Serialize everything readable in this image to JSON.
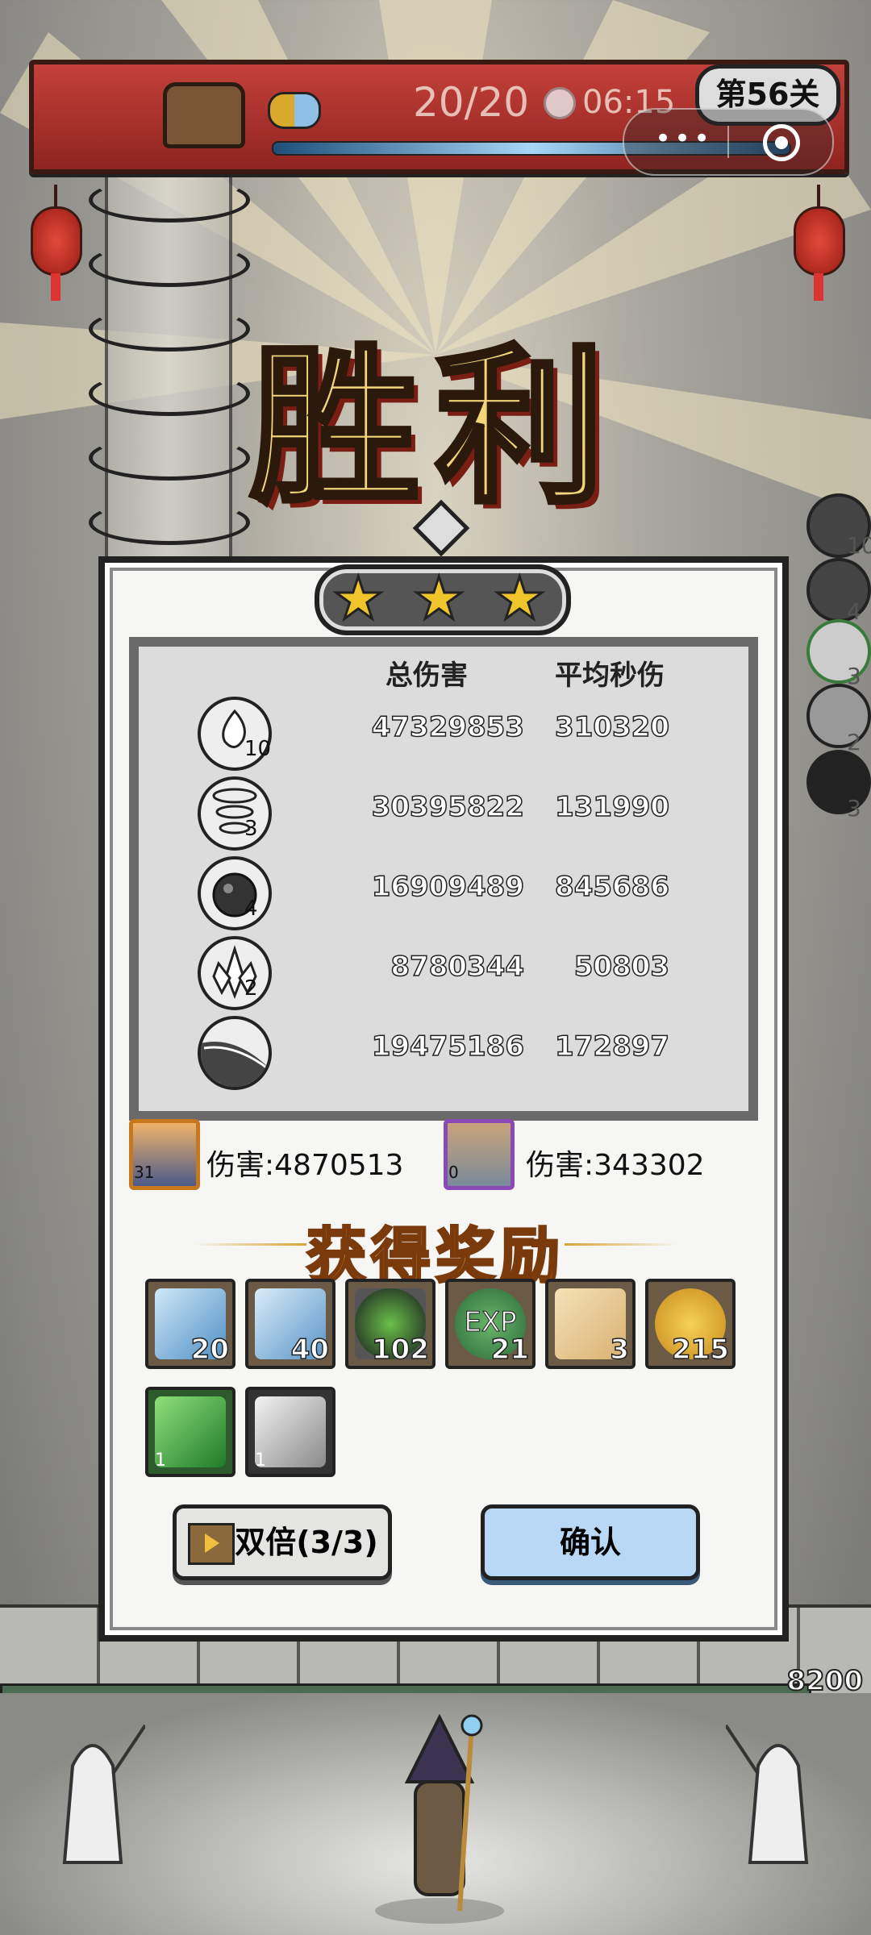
{
  "hud": {
    "wave_counter": "20/20",
    "timer": "06:15",
    "level": "第56关"
  },
  "victory_title": "胜利",
  "stats": {
    "header_total": "总伤害",
    "header_dps": "平均秒伤",
    "rows": [
      {
        "icon": "water-splash-icon",
        "level": "10",
        "total": "47329853",
        "dps": "310320"
      },
      {
        "icon": "tornado-icon",
        "level": "3",
        "total": "30395822",
        "dps": "131990"
      },
      {
        "icon": "bomb-icon",
        "level": "4",
        "total": "16909489",
        "dps": "845686"
      },
      {
        "icon": "ice-crystal-icon",
        "level": "2",
        "total": "8780344",
        "dps": "50803"
      },
      {
        "icon": "slash-icon",
        "level": "",
        "total": "19475186",
        "dps": "172897"
      }
    ]
  },
  "side_skills": [
    {
      "icon": "water-splash-icon",
      "count": "10"
    },
    {
      "icon": "bomb-icon",
      "count": "4"
    },
    {
      "icon": "tornado-icon",
      "count": "3"
    },
    {
      "icon": "ice-crystal-icon",
      "count": "2"
    },
    {
      "icon": "slash-icon",
      "count": "3"
    }
  ],
  "heroes": [
    {
      "name": "hero-1",
      "level": "31",
      "damage": "伤害:4870513"
    },
    {
      "name": "hero-2",
      "level": "0",
      "damage": "伤害:343302"
    }
  ],
  "reward_title": "获得奖励",
  "rewards": [
    {
      "icon": "lightning-ice-shard-icon",
      "count": "20"
    },
    {
      "icon": "ice-rock-shard-icon",
      "count": "40"
    },
    {
      "icon": "green-leaf-emblem-icon",
      "count": "102"
    },
    {
      "icon": "exp-orb-icon",
      "count": "21",
      "label": "EXP"
    },
    {
      "icon": "scroll-icon",
      "count": "3"
    },
    {
      "icon": "gold-coin-icon",
      "count": "215"
    },
    {
      "icon": "green-crystal-icon",
      "count": "1"
    },
    {
      "icon": "silver-ore-icon",
      "count": "1"
    }
  ],
  "buttons": {
    "double": "双倍(3/3)",
    "confirm": "确认"
  },
  "base_hp": "8200"
}
